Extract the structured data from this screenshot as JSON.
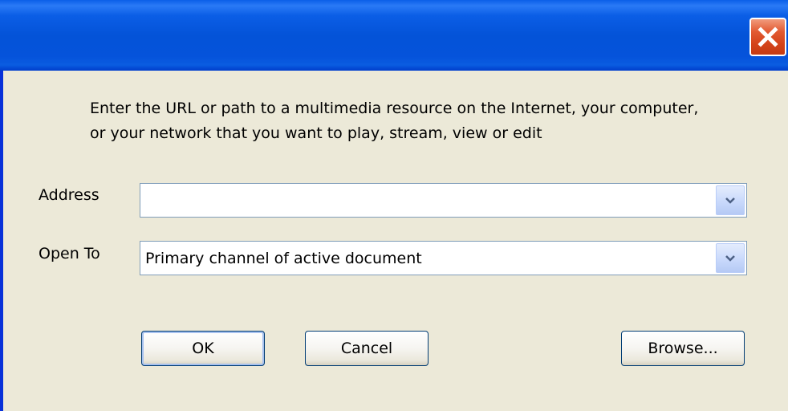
{
  "dialog": {
    "title": "",
    "instructions_line1": "Enter the URL or path to a multimedia resource on the Internet, your computer,",
    "instructions_line2": "or your network that you want to play, stream, view or edit",
    "close_icon": "close-icon"
  },
  "address": {
    "label": "Address",
    "value": ""
  },
  "open_to": {
    "label": "Open To",
    "value": "Primary channel of active document"
  },
  "buttons": {
    "ok": "OK",
    "cancel": "Cancel",
    "browse": "Browse..."
  },
  "colors": {
    "titlebar": "#0453d8",
    "close_button": "#d4431a",
    "dialog_background": "#ece9d8"
  }
}
